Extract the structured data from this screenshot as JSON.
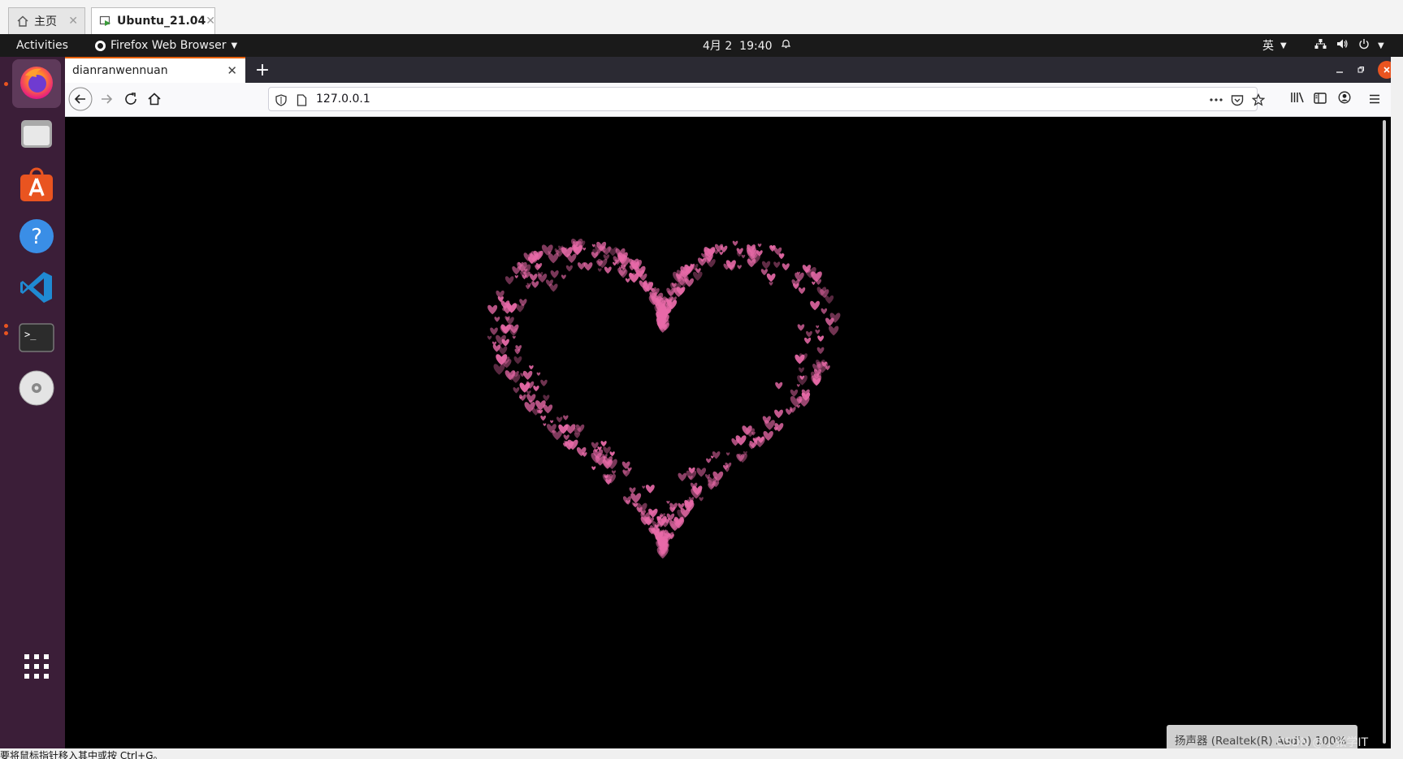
{
  "vm_tabs": [
    {
      "label": "主页",
      "icon": "home-icon",
      "close": "✕"
    },
    {
      "label": "Ubuntu_21.04",
      "icon": "vm-icon",
      "close": "✕"
    }
  ],
  "topbar": {
    "activities": "Activities",
    "app_menu": "Firefox Web Browser",
    "datetime": "4月 2  19:40",
    "input_method": "英"
  },
  "dock": [
    "firefox-icon",
    "files-icon",
    "software-icon",
    "help-icon",
    "vscode-icon",
    "terminal-icon",
    "disc-icon",
    "apps-grid-icon"
  ],
  "firefox": {
    "tab_title": "dianranwennuan",
    "tab_close": "✕",
    "new_tab": "+",
    "url": "127.0.0.1"
  },
  "osd_text": "扬声器 (Realtek(R) Audio) 100%",
  "watermark": "CSDN @小张学IT",
  "status_text": "要将鼠标指针移入其中或按 Ctrl+G。",
  "colors": {
    "heart": "#e86aa8",
    "accent": "#e95420",
    "dock": "#3b1e38"
  }
}
